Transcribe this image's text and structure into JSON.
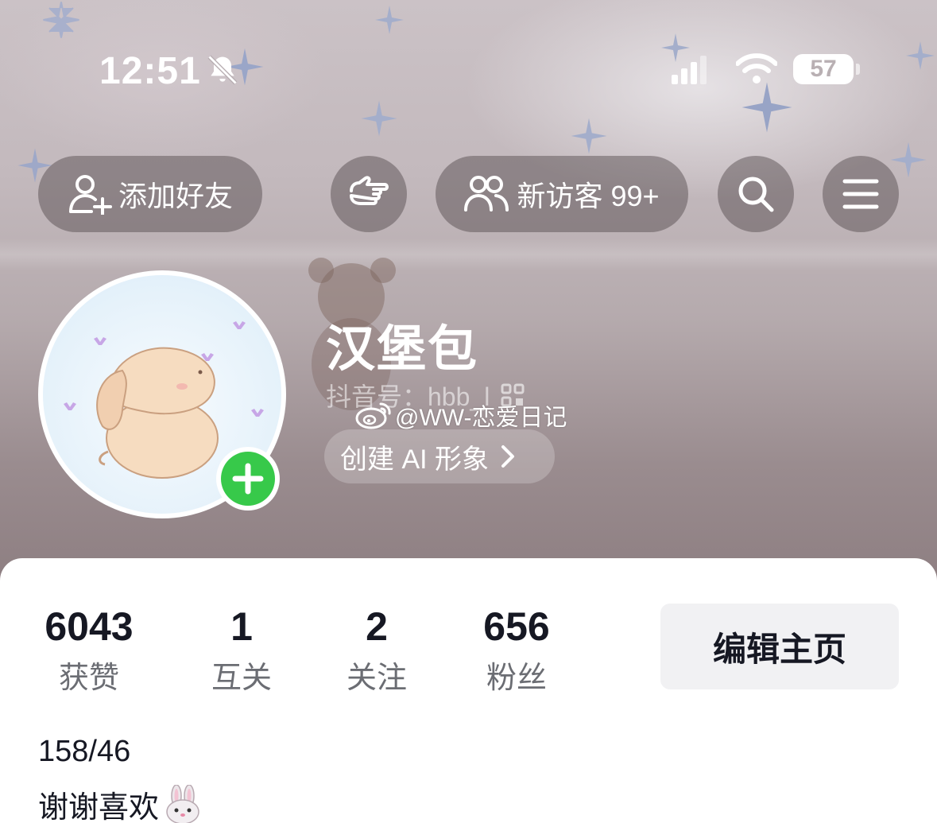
{
  "status_bar": {
    "time": "12:51",
    "battery": "57"
  },
  "top_actions": {
    "add_friend": "添加好友",
    "visitors": "新访客 99+"
  },
  "profile": {
    "nickname": "汉堡包",
    "account_id": "抖音号：hbb_l",
    "watermark": "@WW-恋爱日记",
    "create_ai": "创建 AI 形象"
  },
  "stats": [
    {
      "value": "6043",
      "label": "获赞"
    },
    {
      "value": "1",
      "label": "互关"
    },
    {
      "value": "2",
      "label": "关注"
    },
    {
      "value": "656",
      "label": "粉丝"
    }
  ],
  "edit_profile": "编辑主页",
  "bio": {
    "line1": "158/46",
    "line2": "谢谢喜欢"
  },
  "colors": {
    "accent_green": "#37c94a",
    "text_primary": "#161823",
    "text_secondary": "#6b6d73"
  }
}
